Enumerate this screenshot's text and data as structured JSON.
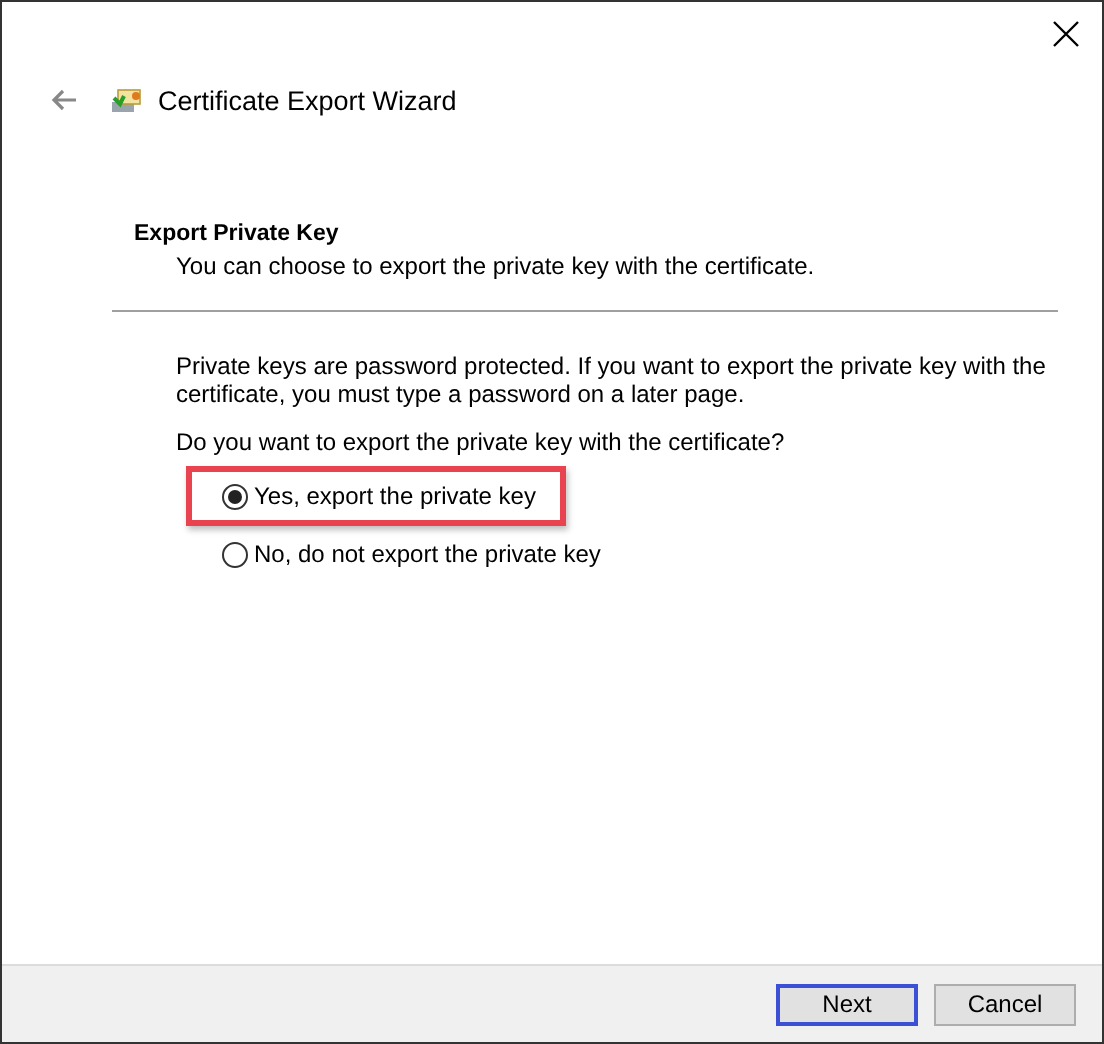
{
  "window": {
    "title": "Certificate Export Wizard"
  },
  "page": {
    "heading": "Export Private Key",
    "subheading": "You can choose to export the private key with the certificate."
  },
  "body": {
    "paragraph": "Private keys are password protected. If you want to export the private key with the certificate, you must type a password on a later page.",
    "question": "Do you want to export the private key with the certificate?"
  },
  "options": [
    {
      "label": "Yes, export the private key",
      "selected": true,
      "highlighted": true
    },
    {
      "label": "No, do not export the private key",
      "selected": false,
      "highlighted": false
    }
  ],
  "buttons": [
    {
      "label": "Next",
      "default": true
    },
    {
      "label": "Cancel",
      "default": false
    }
  ]
}
